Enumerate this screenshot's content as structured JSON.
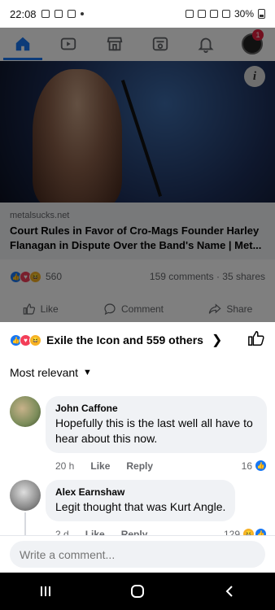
{
  "status_bar": {
    "time": "22:08",
    "battery": "30%"
  },
  "nav": {
    "notification_count": "1"
  },
  "post": {
    "domain": "metalsucks.net",
    "title": "Court Rules in Favor of Cro-Mags Founder Harley Flanagan in Dispute Over the Band's Name | Met...",
    "reaction_count": "560",
    "comments": "159 comments",
    "shares": "35 shares",
    "actions": {
      "like": "Like",
      "comment": "Comment",
      "share": "Share"
    }
  },
  "sheet": {
    "reaction_summary": "Exile the Icon and 559 others",
    "sort_label": "Most relevant",
    "comments": [
      {
        "author": "John Caffone",
        "text": "Hopefully this is the last well all have to hear about this now.",
        "time": "20 h",
        "like": "Like",
        "reply": "Reply",
        "reactions": "16"
      },
      {
        "author": "Alex Earnshaw",
        "text": "Legit thought that was Kurt Angle.",
        "time": "2 d",
        "like": "Like",
        "reply": "Reply",
        "reactions": "129"
      }
    ],
    "write_placeholder": "Write a comment..."
  }
}
